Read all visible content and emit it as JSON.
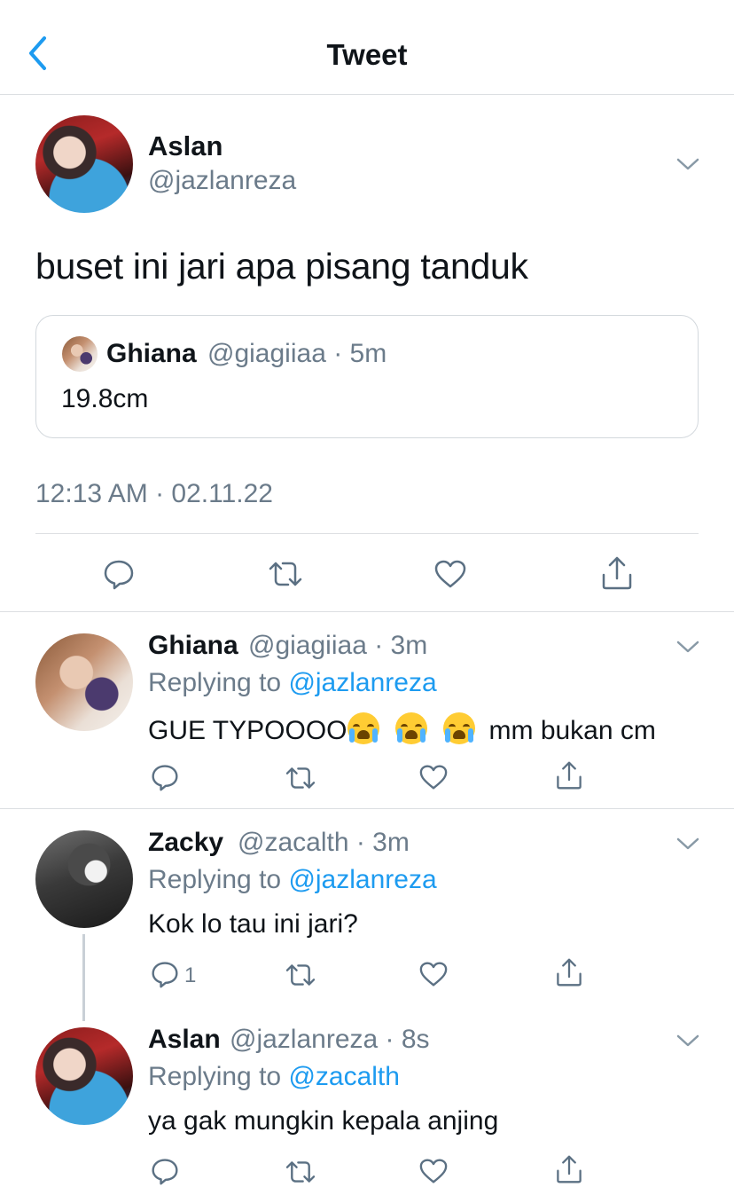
{
  "header": {
    "title": "Tweet",
    "back_icon": "chevron-left-icon"
  },
  "main_tweet": {
    "name": "Aslan",
    "handle": "@jazlanreza",
    "text": "buset ini jari apa pisang tanduk",
    "timestamp": "12:13 AM · 02.11.22",
    "quote": {
      "name": "Ghiana",
      "meta": "@giagiiaa · 5m",
      "text": "19.8cm"
    }
  },
  "replies": [
    {
      "name": "Ghiana",
      "meta": "@giagiiaa · 3m",
      "replying_prefix": "Replying to ",
      "replying_to": "@jazlanreza",
      "text_before": "GUE TYPOOOO",
      "emojis": [
        "loudly-crying-face",
        "loudly-crying-face",
        "loudly-crying-face"
      ],
      "text_after": "mm bukan cm",
      "reply_count": ""
    },
    {
      "name": "Zacky",
      "meta": "@zacalth · 3m",
      "replying_prefix": "Replying to ",
      "replying_to": "@jazlanreza",
      "text": "Kok lo tau ini jari?",
      "reply_count": "1"
    },
    {
      "name": "Aslan",
      "meta": "@jazlanreza · 8s",
      "replying_prefix": "Replying to ",
      "replying_to": "@zacalth",
      "text": "ya gak mungkin kepala anjing",
      "reply_count": ""
    }
  ],
  "colors": {
    "link": "#1d9bf0",
    "secondary_text": "#6b7b8a",
    "icon": "#5b7083",
    "divider": "#dcdfe2"
  }
}
